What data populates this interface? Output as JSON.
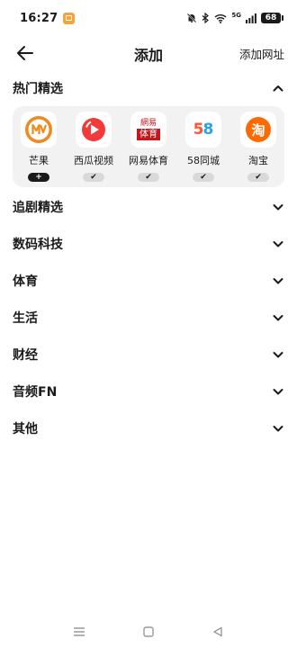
{
  "status_bar": {
    "time": "16:27",
    "network": "5G",
    "battery": "68"
  },
  "header": {
    "title": "添加",
    "add_url": "添加网址"
  },
  "sections": {
    "hot": "热门精选",
    "drama": "追剧精选",
    "tech": "数码科技",
    "sports": "体育",
    "life": "生活",
    "finance": "财经",
    "audio": "音频FN",
    "other": "其他"
  },
  "apps": [
    {
      "name": "芒果",
      "icon": "mango-tv-icon",
      "state": "add",
      "mark": "+"
    },
    {
      "name": "西瓜视频",
      "icon": "xigua-video-icon",
      "state": "added",
      "mark": "✔"
    },
    {
      "name": "网易体育",
      "icon": "netease-sports-icon",
      "state": "added",
      "mark": "✔",
      "logo_top": "網易",
      "logo_bottom": "体育"
    },
    {
      "name": "58同城",
      "icon": "58-tongcheng-icon",
      "state": "added",
      "mark": "✔",
      "logo_five": "5",
      "logo_eight": "8"
    },
    {
      "name": "淘宝",
      "icon": "taobao-icon",
      "state": "added",
      "mark": "✔",
      "logo_char": "淘"
    }
  ],
  "colors": {
    "accent_orange": "#f08a1e",
    "xigua_red": "#f23a3a",
    "netease_red": "#c8161d",
    "taobao_orange": "#ff6a00",
    "card_bg": "#f2f2f2"
  }
}
